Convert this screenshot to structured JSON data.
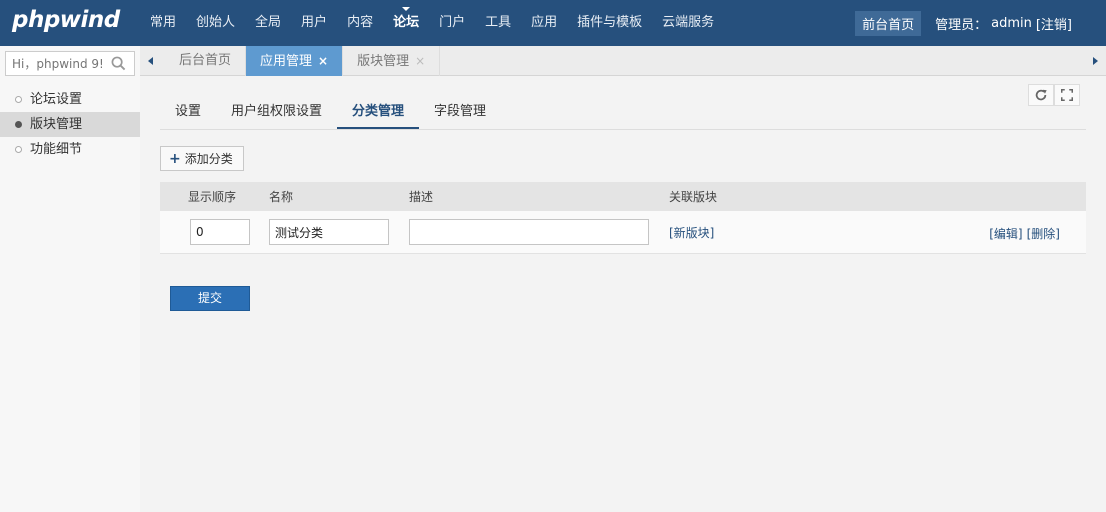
{
  "header": {
    "logo": "phpwind",
    "nav": [
      {
        "label": "常用"
      },
      {
        "label": "创始人"
      },
      {
        "label": "全局"
      },
      {
        "label": "用户"
      },
      {
        "label": "内容"
      },
      {
        "label": "论坛",
        "active": true
      },
      {
        "label": "门户"
      },
      {
        "label": "工具"
      },
      {
        "label": "应用"
      },
      {
        "label": "插件与模板"
      },
      {
        "label": "云端服务"
      }
    ],
    "front_page": "前台首页",
    "admin_label": "管理员：",
    "admin_name": "admin",
    "logout": "[注销]"
  },
  "sidebar": {
    "search_placeholder": "Hi，phpwind 9!",
    "items": [
      {
        "label": "论坛设置"
      },
      {
        "label": "版块管理",
        "active": true
      },
      {
        "label": "功能细节"
      }
    ]
  },
  "tabs": [
    {
      "label": "后台首页"
    },
    {
      "label": "应用管理",
      "active": true,
      "close": "×"
    },
    {
      "label": "版块管理",
      "close": "×"
    }
  ],
  "subtabs": [
    {
      "label": "设置"
    },
    {
      "label": "用户组权限设置"
    },
    {
      "label": "分类管理",
      "active": true
    },
    {
      "label": "字段管理"
    }
  ],
  "toolbar": {
    "add_label": "添加分类",
    "add_icon": "+"
  },
  "table": {
    "headers": {
      "order": "显示顺序",
      "name": "名称",
      "desc": "描述",
      "forum": "关联版块"
    },
    "rows": [
      {
        "order": "0",
        "name": "测试分类",
        "desc": "",
        "forum": "[新版块]",
        "edit": "[编辑]",
        "delete": "[删除]"
      }
    ]
  },
  "submit_label": "提交",
  "colors": {
    "header_bg": "#26507d",
    "active_tab": "#5e9ad0",
    "submit": "#2b6fb5"
  }
}
